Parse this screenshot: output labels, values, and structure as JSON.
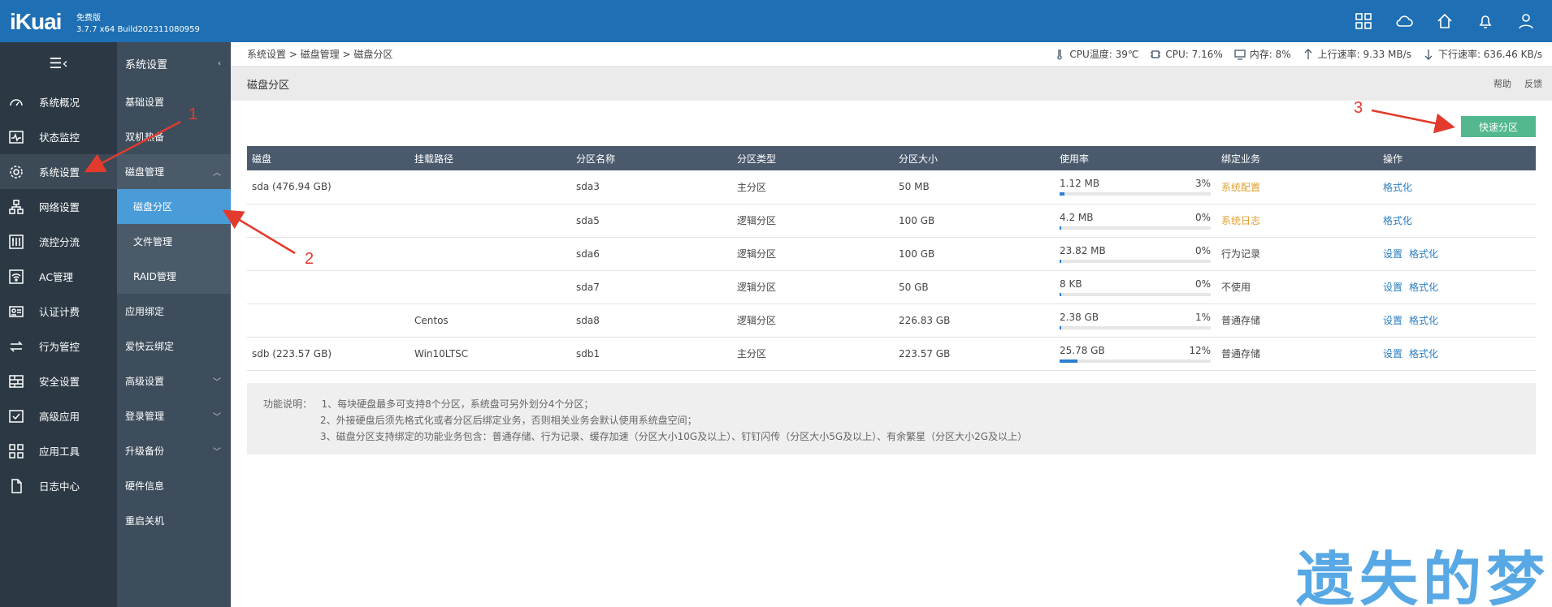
{
  "app": {
    "logo": "iKuai",
    "edition": "免费版",
    "version": "3.7.7 x64 Build202311080959"
  },
  "top_icons": [
    "apps-grid-icon",
    "cloud-icon",
    "home-icon",
    "bell-icon",
    "user-icon"
  ],
  "sidebar": {
    "items": [
      {
        "label": "系统概况",
        "icon": "dashboard-icon"
      },
      {
        "label": "状态监控",
        "icon": "pulse-icon"
      },
      {
        "label": "系统设置",
        "icon": "gear-icon"
      },
      {
        "label": "网络设置",
        "icon": "network-icon"
      },
      {
        "label": "流控分流",
        "icon": "sliders-icon"
      },
      {
        "label": "AC管理",
        "icon": "wifi-icon"
      },
      {
        "label": "认证计费",
        "icon": "id-card-icon"
      },
      {
        "label": "行为管控",
        "icon": "swap-icon"
      },
      {
        "label": "安全设置",
        "icon": "firewall-icon"
      },
      {
        "label": "高级应用",
        "icon": "check-box-icon"
      },
      {
        "label": "应用工具",
        "icon": "tools-icon"
      },
      {
        "label": "日志中心",
        "icon": "document-icon"
      }
    ]
  },
  "submenu": {
    "title": "系统设置",
    "items": [
      {
        "label": "基础设置"
      },
      {
        "label": "双机热备"
      },
      {
        "label": "磁盘管理"
      },
      {
        "label": "磁盘分区"
      },
      {
        "label": "文件管理"
      },
      {
        "label": "RAID管理"
      },
      {
        "label": "应用绑定"
      },
      {
        "label": "爱快云绑定"
      },
      {
        "label": "高级设置"
      },
      {
        "label": "登录管理"
      },
      {
        "label": "升级备份"
      },
      {
        "label": "硬件信息"
      },
      {
        "label": "重启关机"
      }
    ]
  },
  "breadcrumb": "系统设置 > 磁盘管理 > 磁盘分区",
  "status": {
    "cpu_temp": "CPU温度: 39℃",
    "cpu": "CPU: 7.16%",
    "memory": "内存: 8%",
    "upload": "上行速率: 9.33 MB/s",
    "download": "下行速率: 636.46 KB/s"
  },
  "page": {
    "title": "磁盘分区",
    "help": "帮助",
    "feedback": "反馈",
    "quick_button": "快速分区"
  },
  "table": {
    "columns": [
      "磁盘",
      "挂载路径",
      "分区名称",
      "分区类型",
      "分区大小",
      "使用率",
      "绑定业务",
      "操作"
    ],
    "rows": [
      {
        "disk": "sda (476.94 GB)",
        "mount": "",
        "name": "sda3",
        "type": "主分区",
        "size": "50 MB",
        "used": "1.12 MB",
        "pct": "3%",
        "pct_value": 3,
        "bind": "系统配置",
        "bind_color": "#e0a030",
        "ops": [
          "格式化"
        ]
      },
      {
        "disk": "",
        "mount": "",
        "name": "sda5",
        "type": "逻辑分区",
        "size": "100 GB",
        "used": "4.2 MB",
        "pct": "0%",
        "pct_value": 0,
        "bind": "系统日志",
        "bind_color": "#e0a030",
        "ops": [
          "格式化"
        ]
      },
      {
        "disk": "",
        "mount": "",
        "name": "sda6",
        "type": "逻辑分区",
        "size": "100 GB",
        "used": "23.82 MB",
        "pct": "0%",
        "pct_value": 0,
        "bind": "行为记录",
        "bind_color": "#444444",
        "ops": [
          "设置",
          "格式化"
        ]
      },
      {
        "disk": "",
        "mount": "",
        "name": "sda7",
        "type": "逻辑分区",
        "size": "50 GB",
        "used": "8 KB",
        "pct": "0%",
        "pct_value": 0,
        "bind": "不使用",
        "bind_color": "#444444",
        "ops": [
          "设置",
          "格式化"
        ]
      },
      {
        "disk": "",
        "mount": "Centos",
        "name": "sda8",
        "type": "逻辑分区",
        "size": "226.83 GB",
        "used": "2.38 GB",
        "pct": "1%",
        "pct_value": 1,
        "bind": "普通存储",
        "bind_color": "#444444",
        "ops": [
          "设置",
          "格式化"
        ]
      },
      {
        "disk": "sdb (223.57 GB)",
        "mount": "Win10LTSC",
        "name": "sdb1",
        "type": "主分区",
        "size": "223.57 GB",
        "used": "25.78 GB",
        "pct": "12%",
        "pct_value": 12,
        "bind": "普通存储",
        "bind_color": "#444444",
        "ops": [
          "设置",
          "格式化"
        ]
      }
    ]
  },
  "notes": {
    "label": "功能说明：",
    "lines": [
      "1、每块硬盘最多可支持8个分区，系统盘可另外划分4个分区；",
      "2、外接硬盘后须先格式化或者分区后绑定业务，否则相关业务会默认使用系统盘空间；",
      "3、磁盘分区支持绑定的功能业务包含：普通存储、行为记录、缓存加速（分区大小10G及以上）、钉钉闪传（分区大小5G及以上）、有余繁星（分区大小2G及以上）"
    ]
  },
  "annotations": [
    "1",
    "2",
    "3"
  ],
  "watermark": "遗失的梦",
  "colors": {
    "topbar": "#1e6fb3",
    "accent": "#54b88f",
    "annotation": "#e23b2e",
    "active_sub": "#4a9cd9"
  }
}
